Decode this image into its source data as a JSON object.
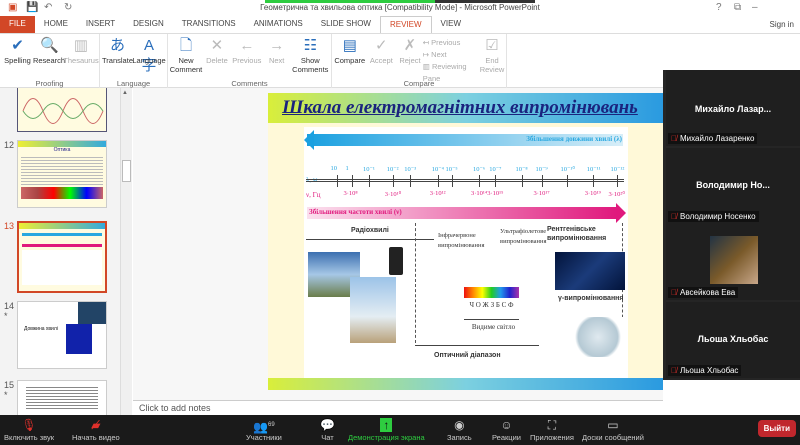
{
  "window": {
    "title": "Геометрична та хвильова оптика [Compatibility Mode] - Microsoft PowerPoint",
    "help": "?",
    "minimize": "–",
    "restore": "⧉"
  },
  "tabs": [
    "FILE",
    "HOME",
    "INSERT",
    "DESIGN",
    "TRANSITIONS",
    "ANIMATIONS",
    "SLIDE SHOW",
    "REVIEW",
    "VIEW"
  ],
  "active_tab": "REVIEW",
  "sign_in": "Sign in",
  "ribbon": {
    "proofing": {
      "label": "Proofing",
      "buttons": [
        "Spelling",
        "Research",
        "Thesaurus"
      ]
    },
    "language": {
      "label": "Language",
      "buttons": [
        "Translate",
        "Language"
      ]
    },
    "comments": {
      "label": "Comments",
      "buttons": [
        "New Comment",
        "Delete",
        "Previous",
        "Next",
        "Show Comments"
      ]
    },
    "compare": {
      "label": "Compare",
      "buttons": [
        "Compare",
        "Accept",
        "Reject"
      ],
      "small": [
        "Previous",
        "Next",
        "Reviewing Pane"
      ],
      "end": "End Review"
    }
  },
  "thumbnails": [
    {
      "num": "12",
      "title": "Оптика"
    },
    {
      "num": "13",
      "selected": true
    },
    {
      "num": "14",
      "star": "*",
      "text": "Довжина хвилі"
    },
    {
      "num": "15",
      "star": "*"
    }
  ],
  "notes_placeholder": "Click to add notes",
  "slide": {
    "title": "Шкала електромагнітних випромінювань",
    "wavelength_arrow": "Збільшення довжини хвилі (λ)",
    "lambda_axis": "λ, м",
    "lambda_ticks": [
      "10",
      "1",
      "10⁻¹",
      "10⁻²",
      "10⁻³",
      "10⁻⁴",
      "10⁻⁵",
      "10⁻⁶",
      "10⁻⁷",
      "10⁻⁸",
      "10⁻⁹",
      "10⁻¹⁰",
      "10⁻¹¹",
      "10⁻¹²"
    ],
    "nu_axis": "ν, Гц",
    "nu_ticks": [
      "3·10⁸",
      "3·10¹⁰",
      "3·10¹²",
      "3·10¹⁴",
      "3·10¹⁵",
      "3·10¹⁷",
      "3·10¹⁹",
      "3·10²⁰"
    ],
    "frequency_arrow": "Збільшення частоти хвилі (ν)",
    "radio": "Радіохвилі",
    "infrared": "Інфрачервоне випромінювання",
    "ultraviolet": "Ультрафіолетове випромінювання",
    "xray": "Рентгенівське випромінювання",
    "spectrum_letters": "Ч О Ж З Б С Ф",
    "visible": "Видиме світло",
    "gamma": "γ-випромінювання",
    "optical": "Оптичний діапазон"
  },
  "participants": [
    {
      "tile_name": "Михайло  Лазар...",
      "label": "Михайло Лазаренко"
    },
    {
      "tile_name": "Володимир  Но...",
      "label": "Володимир Носенко"
    },
    {
      "tile_name": "",
      "label": "Авсейкова Ева",
      "video": true
    },
    {
      "tile_name": "Льоша Хльобас",
      "label": "Льоша Хльобас"
    }
  ],
  "zoom_toolbar": {
    "unmute": "Включить звук",
    "video": "Начать видео",
    "participants": "Участники",
    "participants_count": "69",
    "chat": "Чат",
    "share": "Демонстрация экрана",
    "record": "Запись",
    "reactions": "Реакции",
    "apps": "Приложения",
    "whiteboards": "Доски сообщений",
    "leave": "Выйти"
  },
  "colors": {
    "file_tab": "#d24726",
    "share_green": "#2ecc40",
    "leave_red": "#c0272d",
    "wave_blue": "#29a8e0",
    "freq_pink": "#e0197d"
  }
}
